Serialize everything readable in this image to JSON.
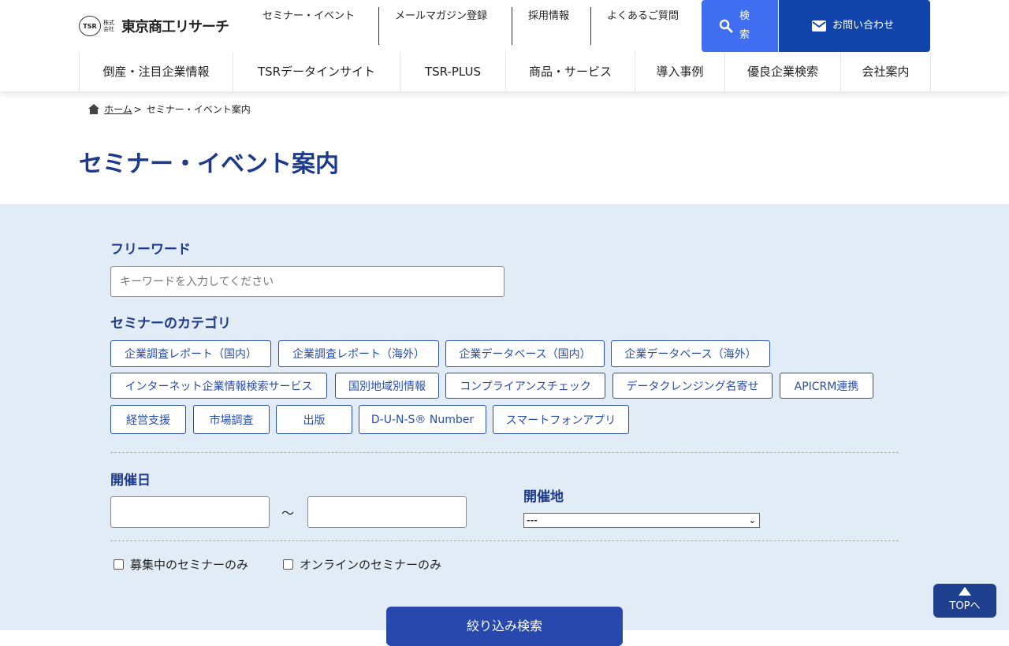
{
  "header": {
    "logo": {
      "mark": "TSR",
      "kabushiki": "株式会社",
      "name": "東京商工リサーチ"
    },
    "util_links": [
      "セミナー・イベント",
      "メールマガジン登録",
      "採用情報",
      "よくあるご質問"
    ],
    "search_label": "検索",
    "contact_label": "お問い合わせ"
  },
  "nav": [
    "倒産・注目企業情報",
    "TSRデータインサイト",
    "TSR-PLUS",
    "商品・サービス",
    "導入事例",
    "優良企業検索",
    "会社案内"
  ],
  "breadcrumb": {
    "home": "ホーム",
    "sep": ">",
    "current": "セミナー・イベント案内"
  },
  "page_title": "セミナー・イベント案内",
  "form": {
    "freeword_label": "フリーワード",
    "freeword_placeholder": "キーワードを入力してください",
    "freeword_value": "",
    "category_label": "セミナーのカテゴリ",
    "categories": [
      "企業調査レポート（国内）",
      "企業調査レポート（海外）",
      "企業データベース（国内）",
      "企業データベース（海外）",
      "インターネット企業情報検索サービス",
      "国別地域別情報",
      "コンプライアンスチェック",
      "データクレンジング名寄せ",
      "APICRM連携",
      "経営支援",
      "市場調査",
      "出版",
      "D-U-N-S® Number",
      "スマートフォンアプリ"
    ],
    "date_label": "開催日",
    "date_sep": "～",
    "place_label": "開催地",
    "place_selected": "---",
    "checkbox_recruiting": "募集中のセミナーのみ",
    "checkbox_online": "オンラインのセミナーのみ",
    "submit_label": "絞り込み検索"
  },
  "to_top": "TOPへ",
  "colors": {
    "primary": "#1e3a8a",
    "search": "#3f6ff0",
    "contact": "#1245ac",
    "panel": "#e2ecf7"
  }
}
